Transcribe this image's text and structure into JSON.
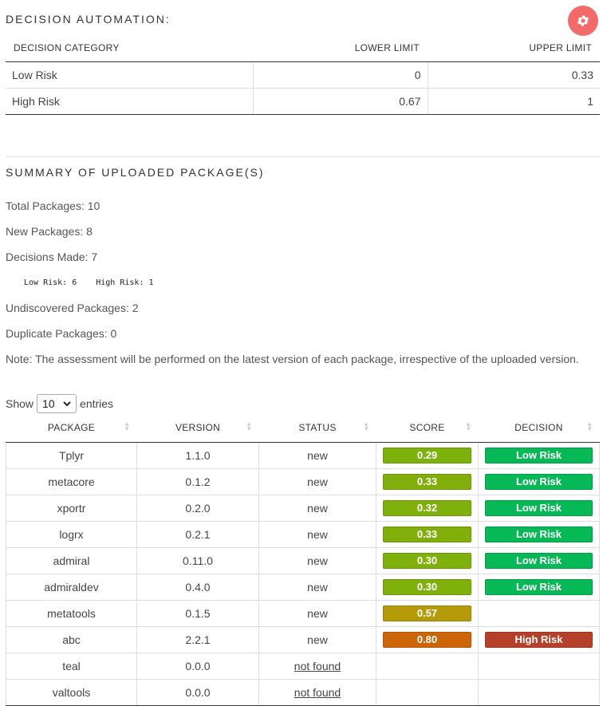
{
  "decision_automation": {
    "title": "DECISION AUTOMATION:",
    "columns": [
      "DECISION CATEGORY",
      "LOWER LIMIT",
      "UPPER LIMIT"
    ],
    "rows": [
      {
        "category": "Low Risk",
        "lower": "0",
        "upper": "0.33"
      },
      {
        "category": "High Risk",
        "lower": "0.67",
        "upper": "1"
      }
    ],
    "gear_icon": "gear-icon",
    "gear_color": "#f26a6a"
  },
  "summary": {
    "title": "SUMMARY OF UPLOADED PACKAGE(S)",
    "total": "Total Packages: 10",
    "new": "New Packages: 8",
    "decisions": "Decisions Made: 7",
    "low_risk_count": "Low Risk: 6",
    "high_risk_count": "High Risk: 1",
    "undiscovered": "Undiscovered Packages: 2",
    "duplicate": "Duplicate Packages: 0",
    "note": "Note: The assessment will be performed on the latest version of each package, irrespective of the uploaded version."
  },
  "table": {
    "show_label": "Show",
    "page_size": "10",
    "entries_label": "entries",
    "columns": [
      "PACKAGE",
      "VERSION",
      "STATUS",
      "SCORE",
      "DECISION"
    ],
    "rows": [
      {
        "package": "Tplyr",
        "version": "1.1.0",
        "status": "new",
        "score": "0.29",
        "score_color": "#7cb20b",
        "decision": "Low Risk",
        "decision_color": "#06b856"
      },
      {
        "package": "metacore",
        "version": "0.1.2",
        "status": "new",
        "score": "0.33",
        "score_color": "#82ae0b",
        "decision": "Low Risk",
        "decision_color": "#06b856"
      },
      {
        "package": "xportr",
        "version": "0.2.0",
        "status": "new",
        "score": "0.32",
        "score_color": "#80b00b",
        "decision": "Low Risk",
        "decision_color": "#06b856"
      },
      {
        "package": "logrx",
        "version": "0.2.1",
        "status": "new",
        "score": "0.33",
        "score_color": "#82ae0b",
        "decision": "Low Risk",
        "decision_color": "#06b856"
      },
      {
        "package": "admiral",
        "version": "0.11.0",
        "status": "new",
        "score": "0.30",
        "score_color": "#7eb10b",
        "decision": "Low Risk",
        "decision_color": "#06b856"
      },
      {
        "package": "admiraldev",
        "version": "0.4.0",
        "status": "new",
        "score": "0.30",
        "score_color": "#7eb10b",
        "decision": "Low Risk",
        "decision_color": "#06b856"
      },
      {
        "package": "metatools",
        "version": "0.1.5",
        "status": "new",
        "score": "0.57",
        "score_color": "#b59a09",
        "decision": "",
        "decision_color": ""
      },
      {
        "package": "abc",
        "version": "2.2.1",
        "status": "new",
        "score": "0.80",
        "score_color": "#cc6508",
        "decision": "High Risk",
        "decision_color": "#b5412a"
      },
      {
        "package": "teal",
        "version": "0.0.0",
        "status": "not found",
        "status_link": true,
        "score": "",
        "score_color": "",
        "decision": "",
        "decision_color": ""
      },
      {
        "package": "valtools",
        "version": "0.0.0",
        "status": "not found",
        "status_link": true,
        "score": "",
        "score_color": "",
        "decision": "",
        "decision_color": ""
      }
    ]
  }
}
